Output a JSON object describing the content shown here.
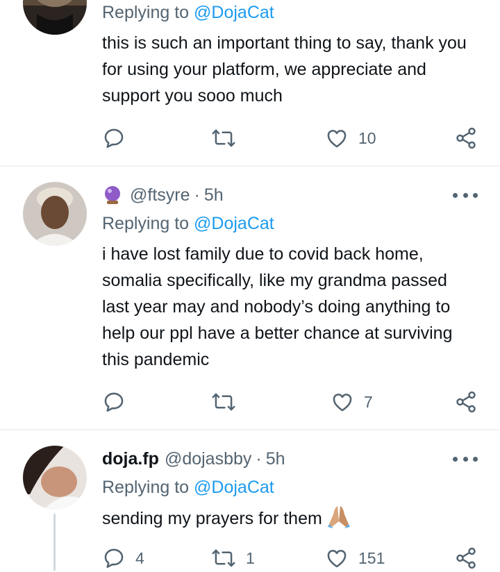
{
  "tweets": [
    {
      "replying_prefix": "Replying to",
      "replying_to": "@DojaCat",
      "text": "this is such an important thing to say, thank you for using your platform, we appreciate and support you sooo much",
      "replies": "",
      "retweets": "",
      "likes": "10"
    },
    {
      "display_name": "",
      "handle": "@ftsyre",
      "separator": "·",
      "time": "5h",
      "replying_prefix": "Replying to",
      "replying_to": "@DojaCat",
      "text": "i have lost family due to covid back home, somalia specifically, like my grandma passed last year may and nobody’s doing anything to help our ppl have a better chance at surviving this pandemic",
      "replies": "",
      "retweets": "",
      "likes": "7"
    },
    {
      "display_name": "doja.fp",
      "handle": "@dojasbby",
      "separator": "·",
      "time": "5h",
      "replying_prefix": "Replying to",
      "replying_to": "@DojaCat",
      "text": "sending my prayers for them",
      "replies": "4",
      "retweets": "1",
      "likes": "151"
    }
  ],
  "icons": {
    "reply": "reply-icon",
    "retweet": "retweet-icon",
    "like": "heart-icon",
    "share": "share-icon",
    "more": "more-icon",
    "crystal_ball": "crystal-ball-emoji",
    "praying_hands": "praying-hands-emoji"
  },
  "colors": {
    "link": "#1d9bf0",
    "secondary_text": "#536471",
    "primary_text": "#0f1419",
    "divider": "#eff3f4"
  }
}
